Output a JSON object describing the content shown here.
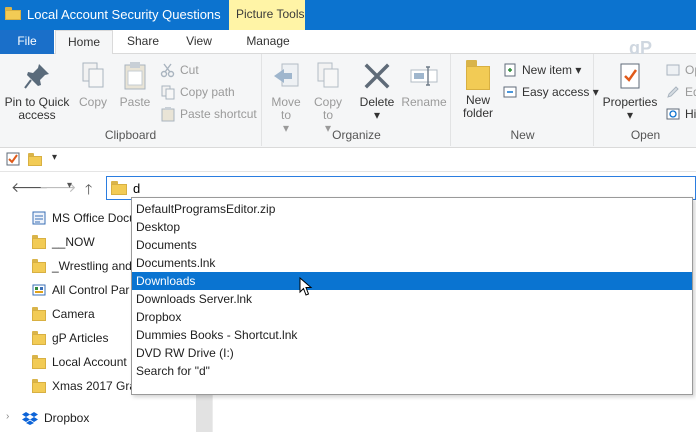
{
  "window": {
    "title": "Local Account Security Questions",
    "context_tab": "Picture Tools",
    "watermark": "gP"
  },
  "ribbon_tabs": [
    "File",
    "Home",
    "Share",
    "View",
    "Manage"
  ],
  "clipboard": {
    "pin_label": "Pin to Quick access",
    "copy_label": "Copy",
    "paste_label": "Paste",
    "cut_label": "Cut",
    "copy_path_label": "Copy path",
    "paste_shortcut_label": "Paste shortcut",
    "group_label": "Clipboard"
  },
  "organize": {
    "move_to_label": "Move to",
    "copy_to_label": "Copy to",
    "delete_label": "Delete",
    "rename_label": "Rename",
    "group_label": "Organize"
  },
  "new_group": {
    "new_folder_label": "New folder",
    "new_item_label": "New item",
    "easy_access_label": "Easy access",
    "group_label": "New"
  },
  "open_group": {
    "properties_label": "Properties",
    "open_label": "Op",
    "edit_label": "Ed",
    "history_label": "His",
    "group_label": "Open"
  },
  "address": {
    "value": "d"
  },
  "nav_items": [
    {
      "label": "MS Office Docu",
      "icon": "document-icon"
    },
    {
      "label": "__NOW",
      "icon": "folder-icon"
    },
    {
      "label": "_Wrestling and",
      "icon": "folder-icon"
    },
    {
      "label": "All Control Par",
      "icon": "control-panel-icon"
    },
    {
      "label": "Camera",
      "icon": "folder-icon"
    },
    {
      "label": "gP Articles",
      "icon": "folder-icon"
    },
    {
      "label": "Local Account",
      "icon": "folder-icon"
    },
    {
      "label": "Xmas 2017 Gra",
      "icon": "folder-icon"
    },
    {
      "label": "Dropbox",
      "icon": "dropbox-icon"
    }
  ],
  "suggestions": [
    "DefaultProgramsEditor.zip",
    "Desktop",
    "Documents",
    "Documents.lnk",
    "Downloads",
    "Downloads Server.lnk",
    "Dropbox",
    "Dummies Books - Shortcut.lnk",
    "DVD RW Drive (I:)",
    "Search for \"d\""
  ],
  "colors": {
    "titlebar": "#0c73cf",
    "context_tab": "#fff4a6",
    "selection": "#0a74d1"
  }
}
